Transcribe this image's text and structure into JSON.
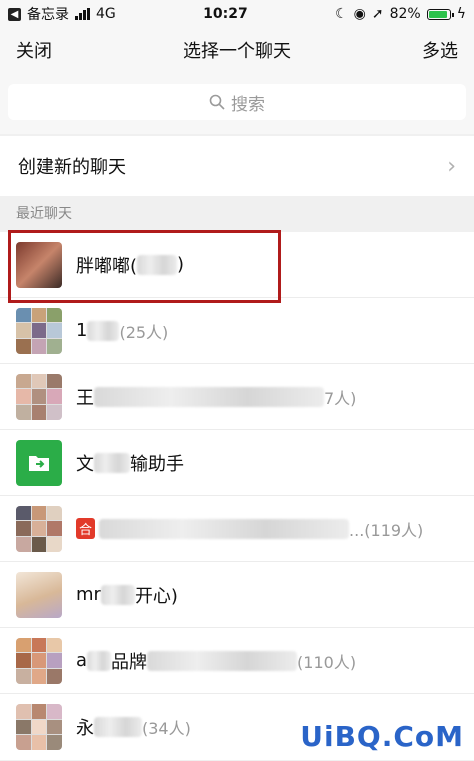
{
  "status": {
    "back_app": "备忘录",
    "network": "4G",
    "time": "10:27",
    "battery": "82%",
    "battery_level": 0.82
  },
  "nav": {
    "close": "关闭",
    "title": "选择一个聊天",
    "multi": "多选"
  },
  "search": {
    "placeholder": "搜索"
  },
  "create_chat": {
    "label": "创建新的聊天"
  },
  "section": {
    "recent": "最近聊天"
  },
  "chats": [
    {
      "name": "胖嘟嘟(",
      "suffix": ")"
    },
    {
      "name": "1",
      "count": "(25人)"
    },
    {
      "name": "王",
      "count": "7人)"
    },
    {
      "name": "文",
      "suffix": "输助手"
    },
    {
      "badge": "合",
      "name": "",
      "count": "...(119人)"
    },
    {
      "name": "mr",
      "suffix": "开心)"
    },
    {
      "name": "a",
      "mid": "品牌",
      "count": "(110人)"
    },
    {
      "name": "永",
      "count": "(34人)"
    }
  ],
  "colors": {
    "highlight": "#b01b1b",
    "file_helper": "#2bad48",
    "accent": "#2cc24b"
  },
  "watermark": "UiBQ.CoM"
}
